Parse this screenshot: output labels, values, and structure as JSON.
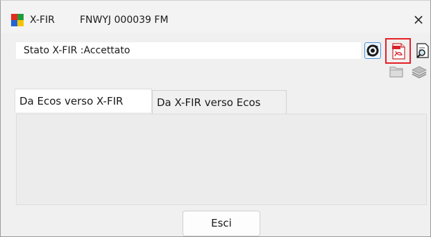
{
  "window": {
    "app_name": "X-FIR",
    "document_id": "FNWYJ 000039 FM",
    "close_symbol": "×"
  },
  "status": {
    "text": "Stato X-FIR :Accettato"
  },
  "toolbar": {
    "icons": [
      "refresh-icon",
      "pdf-icon",
      "print-preview-icon",
      "folder-icon",
      "stack-icon"
    ]
  },
  "tabs": [
    {
      "label": "Da Ecos verso X-FIR",
      "active": true
    },
    {
      "label": "Da X-FIR verso Ecos",
      "active": false
    }
  ],
  "footer": {
    "exit_label": "Esci"
  },
  "colors": {
    "window_bg": "#f0f0f0",
    "highlight": "#e41f26",
    "accent": "#4a90d9"
  }
}
